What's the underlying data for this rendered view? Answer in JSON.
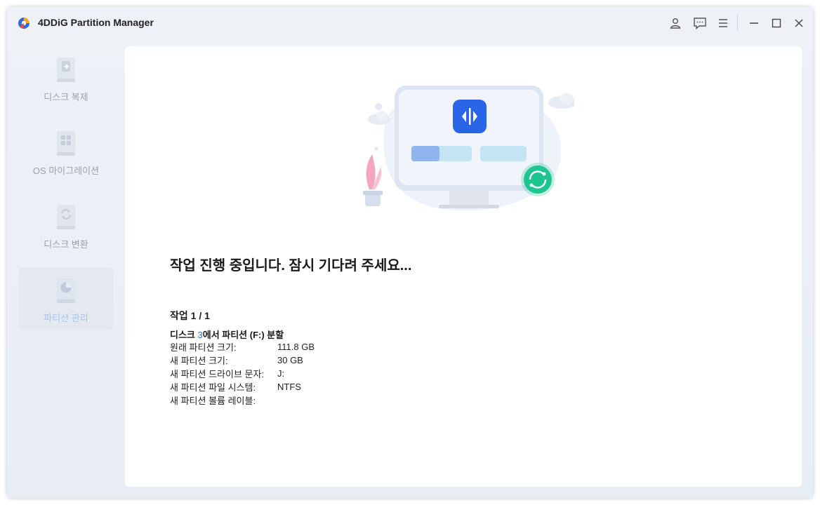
{
  "app": {
    "title": "4DDiG Partition Manager"
  },
  "titlebar_icons": [
    "account-icon",
    "feedback-icon",
    "menu-icon",
    "minimize-icon",
    "maximize-icon",
    "close-icon"
  ],
  "sidebar": {
    "items": [
      {
        "label": "디스크 복제",
        "icon": "disk-clone-icon",
        "active": false
      },
      {
        "label": "OS 마이그레이션",
        "icon": "os-migration-icon",
        "active": false
      },
      {
        "label": "디스크 변환",
        "icon": "disk-convert-icon",
        "active": false
      },
      {
        "label": "파티션 관리",
        "icon": "partition-manage-icon",
        "active": true
      }
    ]
  },
  "main": {
    "status_message": "작업 진행 중입니다. 잠시 기다려 주세요...",
    "task_counter": "작업 1 / 1",
    "task": {
      "title_prefix": "디스크 ",
      "disk_number": "3",
      "title_suffix": "에서 파티션 (F:) 분할",
      "details": [
        {
          "label": "원래 파티션 크기:",
          "value": "111.8 GB"
        },
        {
          "label": "새 파티션 크기:",
          "value": "30 GB"
        },
        {
          "label": "새 파티션 드라이브 문자:",
          "value": "J:"
        },
        {
          "label": "새 파티션 파일 시스템:",
          "value": "NTFS"
        },
        {
          "label": "새 파티션 볼륨 레이블:",
          "value": ""
        }
      ]
    }
  },
  "colors": {
    "accent": "#2f6bdf",
    "sidebar_active_label": "#a9c3ea",
    "sidebar_label": "#9aa0aa",
    "success_badge": "#1ec58f"
  }
}
